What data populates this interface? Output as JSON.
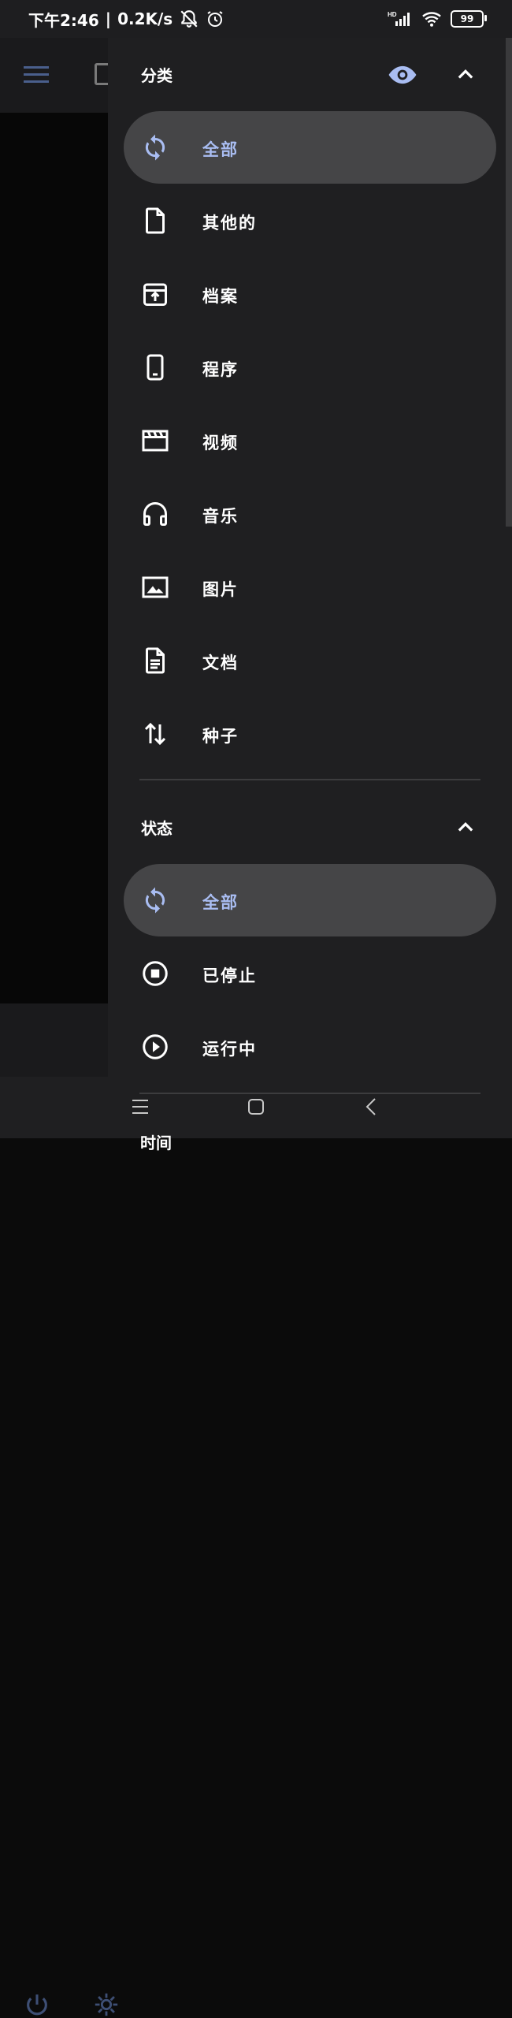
{
  "status_bar": {
    "time": "下午2:46",
    "separator": "|",
    "net_speed": "0.2K/s",
    "battery": "99",
    "signal_label": "HD"
  },
  "drawer": {
    "categories": {
      "title": "分类",
      "items": [
        {
          "label": "全部",
          "icon": "refresh-icon",
          "selected": true
        },
        {
          "label": "其他的",
          "icon": "file-icon",
          "selected": false
        },
        {
          "label": "档案",
          "icon": "archive-icon",
          "selected": false
        },
        {
          "label": "程序",
          "icon": "phone-icon",
          "selected": false
        },
        {
          "label": "视频",
          "icon": "video-icon",
          "selected": false
        },
        {
          "label": "音乐",
          "icon": "headphones-icon",
          "selected": false
        },
        {
          "label": "图片",
          "icon": "image-icon",
          "selected": false
        },
        {
          "label": "文档",
          "icon": "document-icon",
          "selected": false
        },
        {
          "label": "种子",
          "icon": "torrent-icon",
          "selected": false
        }
      ]
    },
    "status": {
      "title": "状态",
      "items": [
        {
          "label": "全部",
          "icon": "refresh-icon",
          "selected": true
        },
        {
          "label": "已停止",
          "icon": "stop-icon",
          "selected": false
        },
        {
          "label": "运行中",
          "icon": "play-icon",
          "selected": false
        }
      ]
    },
    "next_section_peek": "时间"
  },
  "colors": {
    "accent": "#a9bdf2",
    "drawer_bg": "#1f1f21",
    "selected_bg": "#454547"
  }
}
